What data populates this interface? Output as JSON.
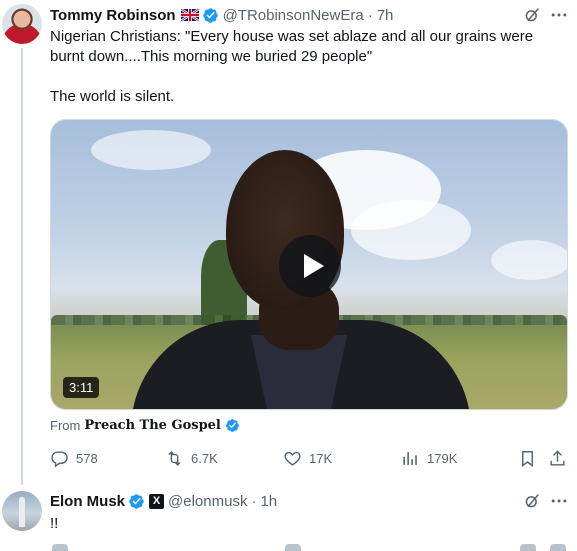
{
  "post1": {
    "author_name": "Tommy Robinson",
    "flag_icon": "uk-flag-icon",
    "handle": "@TRobinsonNewEra",
    "time": "7h",
    "text_line1": "Nigerian Christians: \"Every house was set ablaze and all our grains were burnt down....This morning we buried 29 people\"",
    "text_line2": "The world is silent.",
    "video": {
      "duration": "3:11",
      "from_label": "From",
      "source": "Preach The Gospel"
    },
    "actions": {
      "replies": "578",
      "reposts": "6.7K",
      "likes": "17K",
      "views": "179K"
    }
  },
  "post2": {
    "author_name": "Elon Musk",
    "affiliation_badge": "X",
    "handle": "@elonmusk",
    "time": "1h",
    "text": "!!"
  },
  "colors": {
    "text_primary": "#0f1419",
    "text_secondary": "#536471",
    "verified_blue": "#1d9bf0",
    "thread_line": "#cfd9de"
  }
}
